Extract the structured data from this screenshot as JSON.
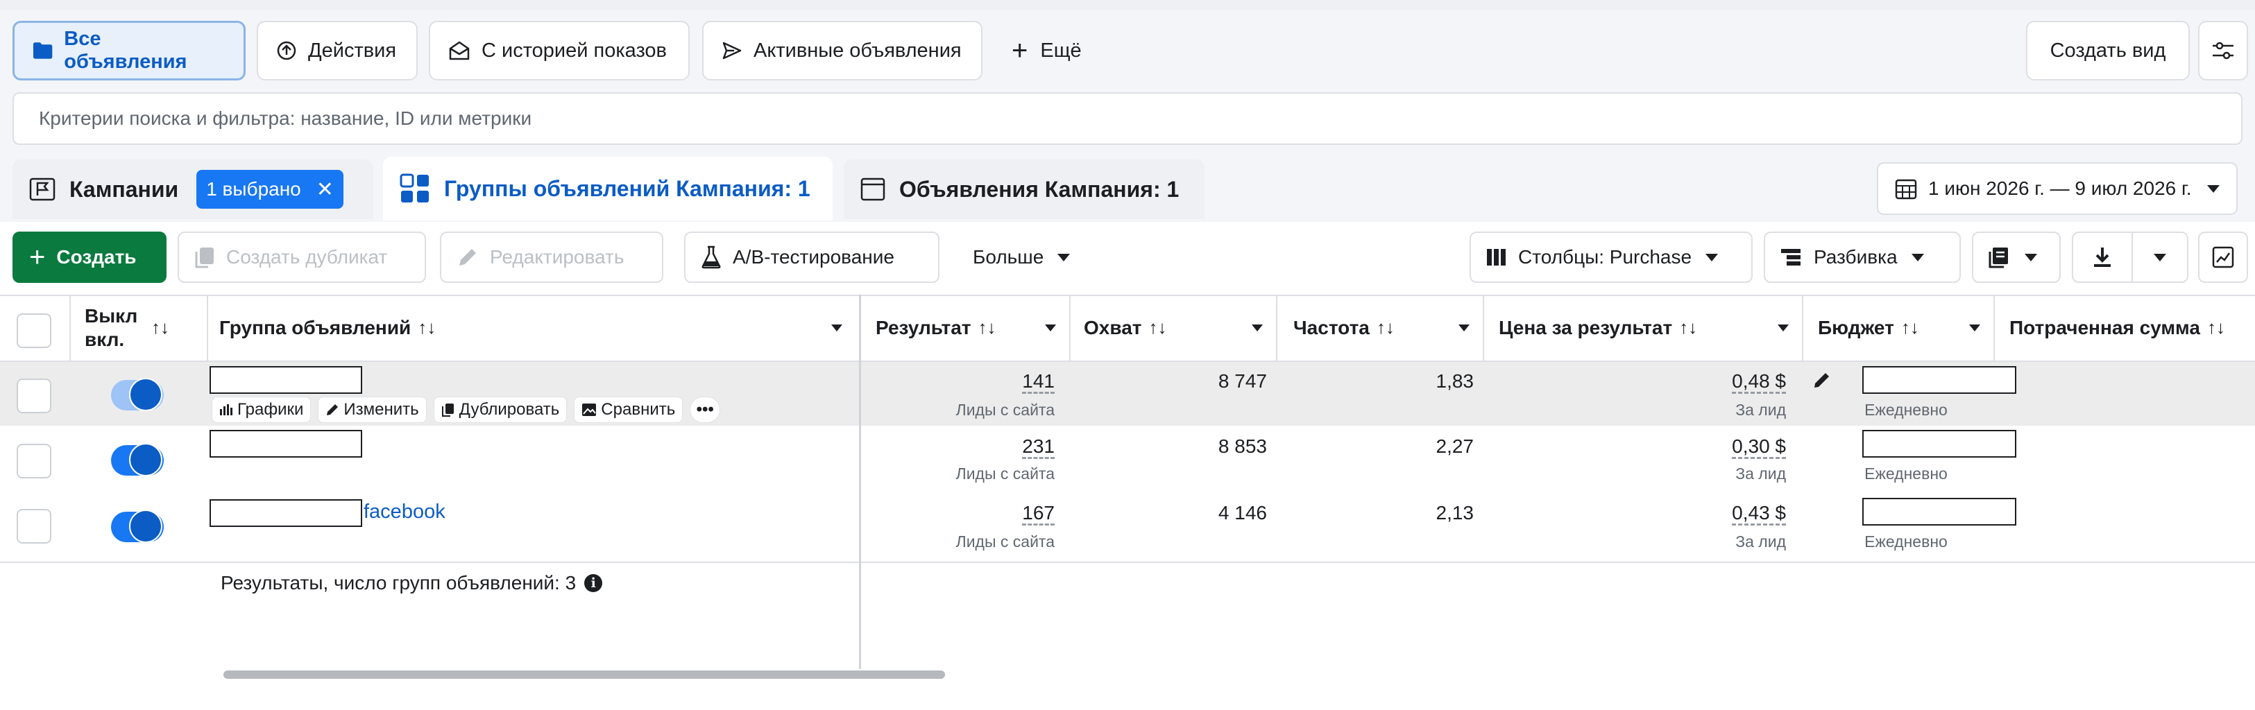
{
  "topbar": {
    "views": [
      {
        "label": "Все объявления",
        "icon": "folder-icon",
        "active": true
      },
      {
        "label": "Действия",
        "icon": "arrow-up-circle-icon",
        "active": false
      },
      {
        "label": "С историей показов",
        "icon": "envelope-open-icon",
        "active": false
      },
      {
        "label": "Активные объявления",
        "icon": "send-icon",
        "active": false
      }
    ],
    "more_label": "Ещё",
    "create_view_label": "Создать вид",
    "settings_icon": "sliders-icon"
  },
  "search": {
    "placeholder": "Критерии поиска и фильтра: название, ID или метрики"
  },
  "tabs": {
    "campaigns": {
      "label": "Кампании",
      "badge": "1 выбрано"
    },
    "adsets": {
      "label": "Группы объявлений Кампания: 1"
    },
    "ads": {
      "label": "Объявления Кампания: 1"
    }
  },
  "date_range": "1 июн 2026 г. — 9 июл 2026 г.",
  "toolbar": {
    "create": "Создать",
    "duplicate": "Создать дубликат",
    "edit": "Редактировать",
    "ab_test": "A/B-тестирование",
    "more": "Больше",
    "columns": "Столбцы: Purchase",
    "breakdown": "Разбивка"
  },
  "table": {
    "headers": {
      "toggle": "Выкл вкл.",
      "name": "Группа объявлений",
      "result": "Результат",
      "reach": "Охват",
      "frequency": "Частота",
      "cost": "Цена за результат",
      "budget": "Бюджет",
      "spent": "Потраченная сумма"
    },
    "row_actions": [
      "Графики",
      "Изменить",
      "Дублировать",
      "Сравнить"
    ],
    "rows": [
      {
        "name_suffix": "",
        "result": "141",
        "result_type": "Лиды с сайта",
        "reach": "8 747",
        "frequency": "1,83",
        "cost": "0,48 $",
        "cost_type": "За лид",
        "budget_type": "Ежедневно"
      },
      {
        "name_suffix": "",
        "result": "231",
        "result_type": "Лиды с сайта",
        "reach": "8 853",
        "frequency": "2,27",
        "cost": "0,30 $",
        "cost_type": "За лид",
        "budget_type": "Ежедневно"
      },
      {
        "name_suffix": "facebook",
        "result": "167",
        "result_type": "Лиды с сайта",
        "reach": "4 146",
        "frequency": "2,13",
        "cost": "0,43 $",
        "cost_type": "За лид",
        "budget_type": "Ежедневно"
      }
    ],
    "summary": "Результаты, число групп объявлений: 3"
  },
  "colors": {
    "accent": "#1877f2",
    "primary_button": "#0a7a3f",
    "active_tab": "#0b5cc4"
  }
}
